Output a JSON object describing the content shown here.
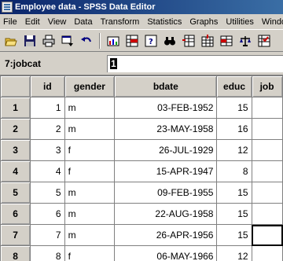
{
  "window": {
    "title": "Employee data - SPSS Data Editor"
  },
  "menubar": {
    "items": [
      "File",
      "Edit",
      "View",
      "Data",
      "Transform",
      "Statistics",
      "Graphs",
      "Utilities",
      "Windows"
    ]
  },
  "toolbar": {
    "buttons": [
      "open-icon",
      "save-icon",
      "print-icon",
      "dialog-recall-icon",
      "undo-icon",
      "goto-chart-icon",
      "goto-case-icon",
      "variables-icon",
      "find-icon",
      "insert-case-icon",
      "insert-variable-icon",
      "split-file-icon",
      "weight-cases-icon",
      "select-cases-icon"
    ]
  },
  "cellbar": {
    "cell_ref": "7:jobcat",
    "cell_value": "1"
  },
  "grid": {
    "columns": [
      "id",
      "gender",
      "bdate",
      "educ",
      "job"
    ],
    "rows": [
      {
        "row": "1",
        "id": "1",
        "gender": "m",
        "bdate": "03-FEB-1952",
        "educ": "15"
      },
      {
        "row": "2",
        "id": "2",
        "gender": "m",
        "bdate": "23-MAY-1958",
        "educ": "16"
      },
      {
        "row": "3",
        "id": "3",
        "gender": "f",
        "bdate": "26-JUL-1929",
        "educ": "12"
      },
      {
        "row": "4",
        "id": "4",
        "gender": "f",
        "bdate": "15-APR-1947",
        "educ": "8"
      },
      {
        "row": "5",
        "id": "5",
        "gender": "m",
        "bdate": "09-FEB-1955",
        "educ": "15"
      },
      {
        "row": "6",
        "id": "6",
        "gender": "m",
        "bdate": "22-AUG-1958",
        "educ": "15"
      },
      {
        "row": "7",
        "id": "7",
        "gender": "m",
        "bdate": "26-APR-1956",
        "educ": "15"
      },
      {
        "row": "8",
        "id": "8",
        "gender": "f",
        "bdate": "06-MAY-1966",
        "educ": "12"
      }
    ]
  }
}
